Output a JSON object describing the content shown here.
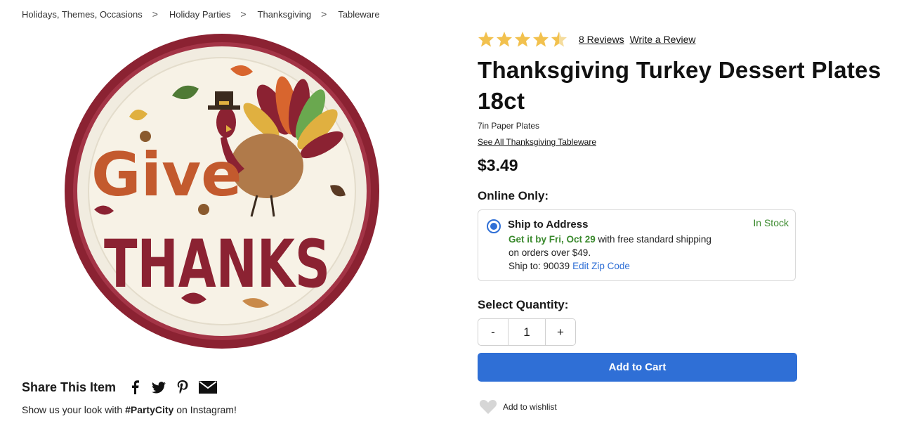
{
  "breadcrumb": [
    "Holidays, Themes, Occasions",
    "Holiday Parties",
    "Thanksgiving",
    "Tableware"
  ],
  "breadcrumb_separator": ">",
  "product": {
    "title": "Thanksgiving Turkey Dessert Plates 18ct",
    "subtitle": "7in Paper Plates",
    "see_all": "See All Thanksgiving Tableware",
    "price": "$3.49",
    "rating": 4.5,
    "rating_max": 5,
    "reviews_label": "8 Reviews",
    "write_review_label": "Write a Review",
    "image_text": {
      "line1": "Give",
      "line2": "THANKS"
    }
  },
  "fulfillment": {
    "heading": "Online Only:",
    "option_title": "Ship to Address",
    "stock": "In Stock",
    "delivery_date": "Get it by Fri, Oct 29",
    "shipping_text": " with free standard shipping",
    "shipping_text2": "on orders over $49.",
    "ship_to_label": "Ship to: 90039",
    "edit_zip": "Edit Zip Code"
  },
  "quantity": {
    "label": "Select Quantity:",
    "minus": "-",
    "value": "1",
    "plus": "+"
  },
  "add_to_cart": "Add to Cart",
  "wishlist": "Add to wishlist",
  "share": {
    "title": "Share This Item",
    "icons": [
      "facebook-icon",
      "twitter-icon",
      "pinterest-icon",
      "email-icon"
    ],
    "insta_prefix": "Show us your look with ",
    "hashtag": "#PartyCity",
    "insta_suffix": " on Instagram!"
  },
  "colors": {
    "accent": "#2f6fd6",
    "stock_green": "#3b8a2e",
    "star": "#f2c14e",
    "plate_rim": "#8b2232"
  }
}
